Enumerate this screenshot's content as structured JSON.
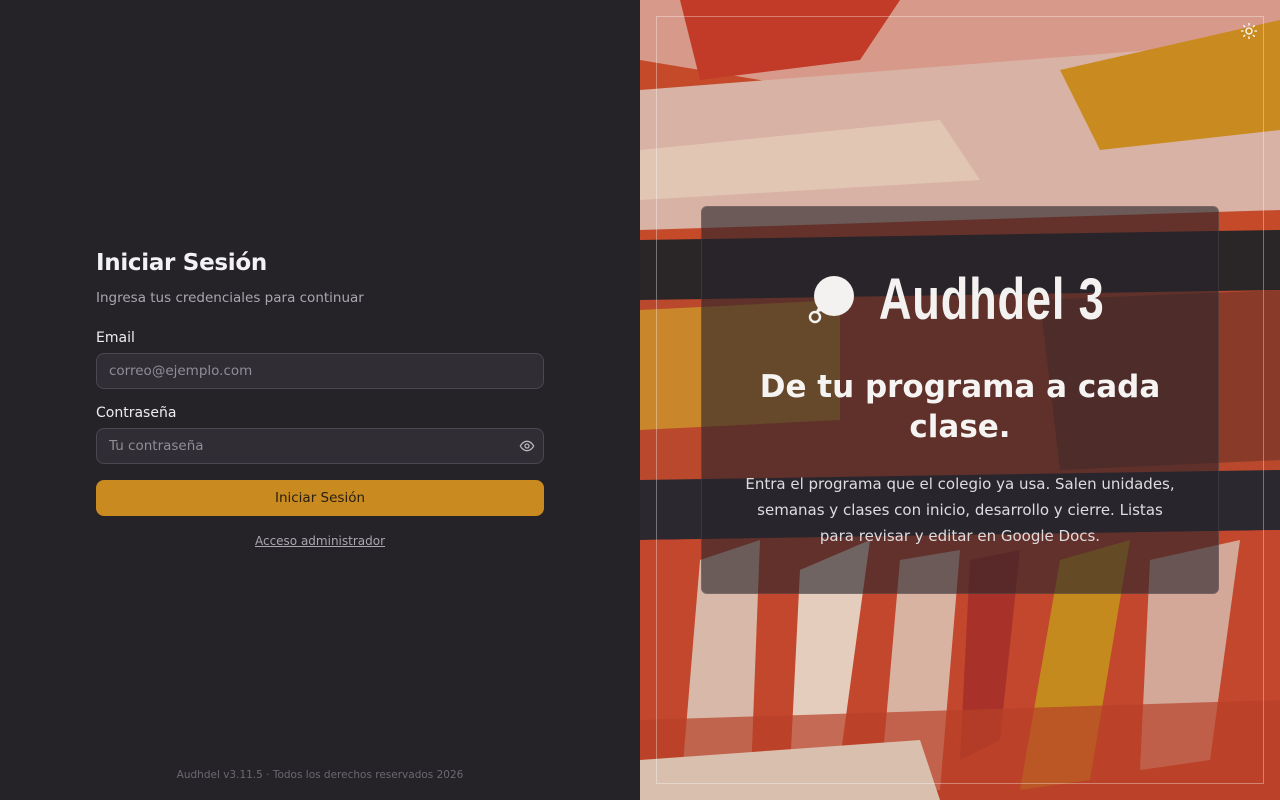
{
  "login": {
    "title": "Iniciar Sesión",
    "subtitle": "Ingresa tus credenciales para continuar",
    "email_label": "Email",
    "email_placeholder": "correo@ejemplo.com",
    "password_label": "Contraseña",
    "password_placeholder": "Tu contraseña",
    "submit_label": "Iniciar Sesión",
    "admin_link": "Acceso administrador",
    "footer": "Audhdel v3.11.5 · Todos los derechos reservados 2026"
  },
  "hero": {
    "brand_name": "Audhdel 3",
    "headline": "De tu programa a cada clase.",
    "description": "Entra el programa que el colegio ya usa. Salen unidades, semanas y clases con inicio, desarrollo y cierre. Listas para revisar y editar en Google Docs."
  },
  "icons": {
    "password_toggle": "eye-icon",
    "theme_toggle": "sun-icon",
    "brand_logo": "speech-bubble-icon"
  },
  "colors": {
    "accent": "#c98a1f",
    "panel_bg": "#252328"
  }
}
